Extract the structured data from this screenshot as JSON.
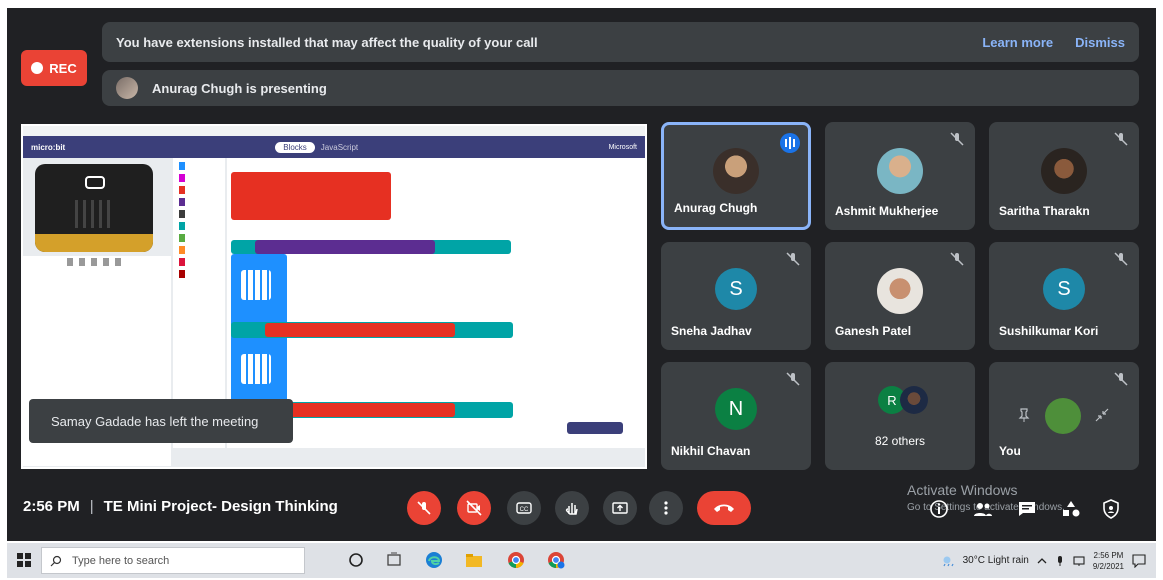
{
  "banner": {
    "text": "You have extensions installed that may affect the quality of your call",
    "learn_more": "Learn more",
    "dismiss": "Dismiss"
  },
  "rec": {
    "label": "REC"
  },
  "presenting": {
    "text": "Anurag Chugh is presenting"
  },
  "toast": {
    "text": "Samay Gadade has left the meeting"
  },
  "participants": [
    {
      "name": "Anurag Chugh",
      "speaking": true,
      "avatar": "photo"
    },
    {
      "name": "Ashmit Mukherjee",
      "muted": true,
      "avatar": "photo"
    },
    {
      "name": "Saritha Tharakn",
      "muted": true,
      "avatar": "photo"
    },
    {
      "name": "Sneha Jadhav",
      "muted": true,
      "initial": "S",
      "color": "#1e88a8"
    },
    {
      "name": "Ganesh Patel",
      "muted": true,
      "avatar": "photo"
    },
    {
      "name": "Sushilkumar Kori",
      "muted": true,
      "initial": "S",
      "color": "#1e88a8"
    },
    {
      "name": "Nikhil Chavan",
      "muted": true,
      "initial": "N",
      "color": "#0b8043"
    },
    {
      "name": "82 others",
      "initial": "R",
      "color": "#0b8043"
    },
    {
      "name": "You",
      "muted": true,
      "initial": "you"
    }
  ],
  "meeting": {
    "time": "2:56 PM",
    "separator": "|",
    "title": "TE Mini Project- Design Thinking"
  },
  "controls": [
    "mic-off",
    "camera-off",
    "captions",
    "raise-hand",
    "present",
    "more",
    "end-call"
  ],
  "watermark": {
    "line1": "Activate Windows",
    "line2": "Go to Settings to activate Windows."
  },
  "taskbar": {
    "search_placeholder": "Type here to search",
    "weather": "30°C  Light rain",
    "time": "2:56 PM",
    "date": "9/2/2021"
  },
  "shared_app": {
    "brand": "micro:bit",
    "blocks_tab": "Blocks",
    "js_tab": "JavaScript",
    "ms": "Microsoft"
  }
}
